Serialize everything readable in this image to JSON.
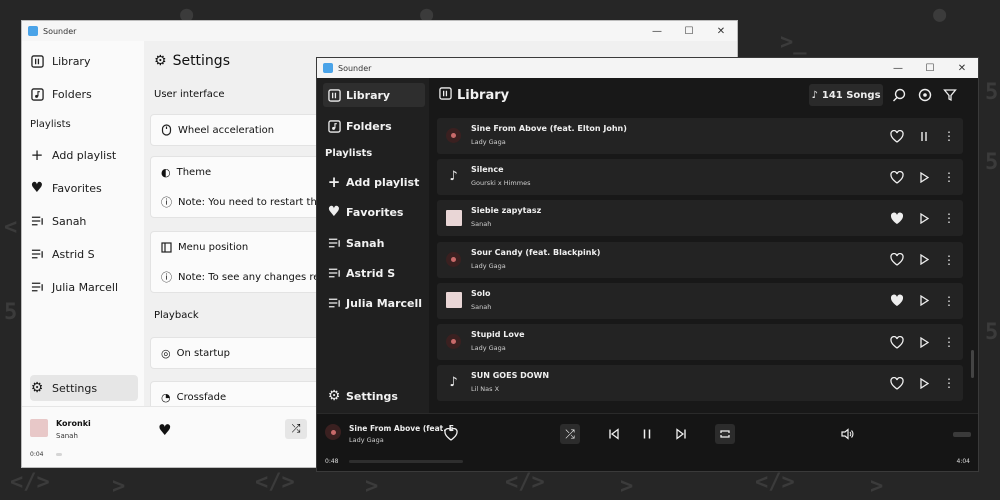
{
  "light_window": {
    "title": "Sounder",
    "sidebar": {
      "library": "Library",
      "folders": "Folders",
      "playlists_heading": "Playlists",
      "add_playlist": "Add playlist",
      "playlists": [
        "Favorites",
        "Sanah",
        "Astrid S",
        "Julia Marcell"
      ],
      "settings": "Settings"
    },
    "settings_page": {
      "title": "Settings",
      "user_interface_heading": "User interface",
      "wheel_acceleration": "Wheel acceleration",
      "theme": "Theme",
      "theme_note": "Note: You need to restart the",
      "menu_position": "Menu position",
      "menu_note": "Note: To see any changes res",
      "playback_heading": "Playback",
      "on_startup": "On startup",
      "crossfade": "Crossfade"
    },
    "player": {
      "title": "Koronki",
      "artist": "Sanah",
      "elapsed": "0:04"
    }
  },
  "dark_window": {
    "title": "Sounder",
    "sidebar": {
      "library": "Library",
      "folders": "Folders",
      "playlists_heading": "Playlists",
      "add_playlist": "Add playlist",
      "playlists": [
        "Favorites",
        "Sanah",
        "Astrid S",
        "Julia Marcell"
      ],
      "settings": "Settings"
    },
    "library_page": {
      "title": "Library",
      "song_count": "141 Songs"
    },
    "songs": [
      {
        "title": "Sine From Above (feat. Elton John)",
        "artist": "Lady Gaga"
      },
      {
        "title": "Silence",
        "artist": "Gourski x Himmes"
      },
      {
        "title": "Siebie zapytasz",
        "artist": "Sanah"
      },
      {
        "title": "Sour Candy (feat. Blackpink)",
        "artist": "Lady Gaga"
      },
      {
        "title": "Solo",
        "artist": "Sanah"
      },
      {
        "title": "Stupid Love",
        "artist": "Lady Gaga"
      },
      {
        "title": "SUN GOES DOWN",
        "artist": "Lil Nas X"
      }
    ],
    "player": {
      "title": "Sine From Above (feat. E",
      "artist": "Lady Gaga",
      "elapsed": "0:48",
      "duration": "4:04"
    }
  }
}
